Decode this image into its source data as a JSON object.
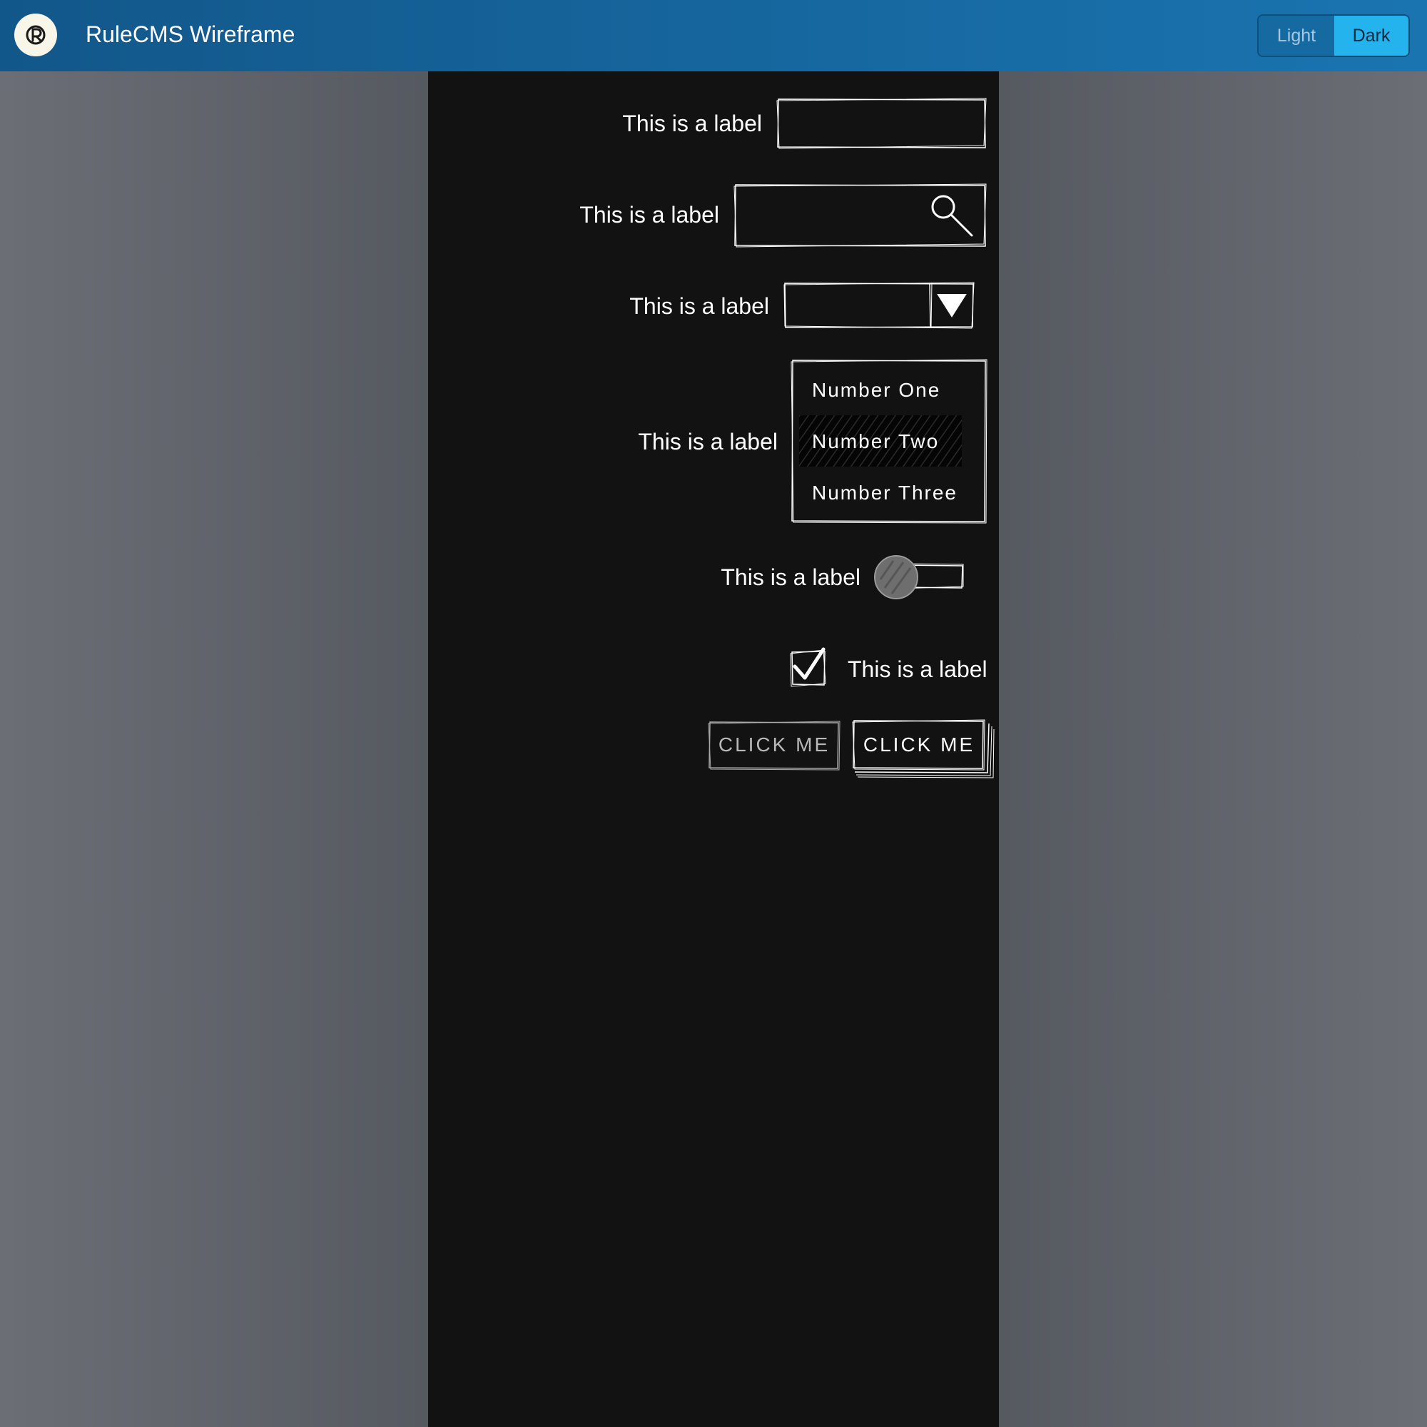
{
  "app": {
    "title": "RuleCMS Wireframe",
    "theme_light": "Light",
    "theme_dark": "Dark"
  },
  "form": {
    "text_input": {
      "label": "This is a label",
      "value": ""
    },
    "search_input": {
      "label": "This is a label",
      "value": ""
    },
    "dropdown": {
      "label": "This is a label",
      "selected": ""
    },
    "listbox": {
      "label": "This is a label",
      "items": [
        "Number One",
        "Number Two",
        "Number Three"
      ],
      "selected_index": 1
    },
    "toggle": {
      "label": "This is a label",
      "on": false
    },
    "checkbox": {
      "label": "This is a label",
      "checked": true
    },
    "buttons": {
      "secondary_label": "CLICK ME",
      "primary_label": "CLICK ME"
    }
  },
  "colors": {
    "topbar": "#1a74b0",
    "accent": "#25b3ee",
    "panel": "#121212",
    "sketch": "#ffffff"
  }
}
